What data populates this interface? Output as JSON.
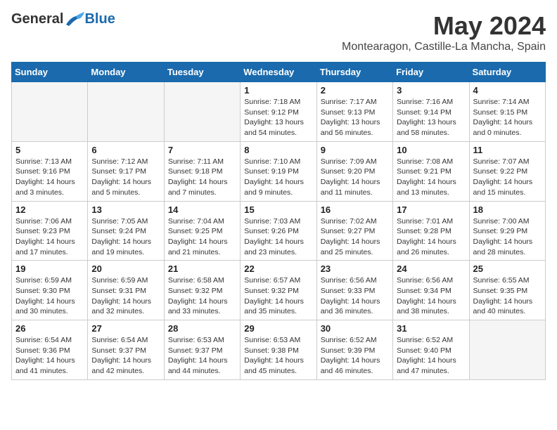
{
  "header": {
    "logo_general": "General",
    "logo_blue": "Blue",
    "title": "May 2024",
    "subtitle": "Montearagon, Castille-La Mancha, Spain"
  },
  "days_of_week": [
    "Sunday",
    "Monday",
    "Tuesday",
    "Wednesday",
    "Thursday",
    "Friday",
    "Saturday"
  ],
  "weeks": [
    [
      {
        "day": "",
        "info": ""
      },
      {
        "day": "",
        "info": ""
      },
      {
        "day": "",
        "info": ""
      },
      {
        "day": "1",
        "info": "Sunrise: 7:18 AM\nSunset: 9:12 PM\nDaylight: 13 hours\nand 54 minutes."
      },
      {
        "day": "2",
        "info": "Sunrise: 7:17 AM\nSunset: 9:13 PM\nDaylight: 13 hours\nand 56 minutes."
      },
      {
        "day": "3",
        "info": "Sunrise: 7:16 AM\nSunset: 9:14 PM\nDaylight: 13 hours\nand 58 minutes."
      },
      {
        "day": "4",
        "info": "Sunrise: 7:14 AM\nSunset: 9:15 PM\nDaylight: 14 hours\nand 0 minutes."
      }
    ],
    [
      {
        "day": "5",
        "info": "Sunrise: 7:13 AM\nSunset: 9:16 PM\nDaylight: 14 hours\nand 3 minutes."
      },
      {
        "day": "6",
        "info": "Sunrise: 7:12 AM\nSunset: 9:17 PM\nDaylight: 14 hours\nand 5 minutes."
      },
      {
        "day": "7",
        "info": "Sunrise: 7:11 AM\nSunset: 9:18 PM\nDaylight: 14 hours\nand 7 minutes."
      },
      {
        "day": "8",
        "info": "Sunrise: 7:10 AM\nSunset: 9:19 PM\nDaylight: 14 hours\nand 9 minutes."
      },
      {
        "day": "9",
        "info": "Sunrise: 7:09 AM\nSunset: 9:20 PM\nDaylight: 14 hours\nand 11 minutes."
      },
      {
        "day": "10",
        "info": "Sunrise: 7:08 AM\nSunset: 9:21 PM\nDaylight: 14 hours\nand 13 minutes."
      },
      {
        "day": "11",
        "info": "Sunrise: 7:07 AM\nSunset: 9:22 PM\nDaylight: 14 hours\nand 15 minutes."
      }
    ],
    [
      {
        "day": "12",
        "info": "Sunrise: 7:06 AM\nSunset: 9:23 PM\nDaylight: 14 hours\nand 17 minutes."
      },
      {
        "day": "13",
        "info": "Sunrise: 7:05 AM\nSunset: 9:24 PM\nDaylight: 14 hours\nand 19 minutes."
      },
      {
        "day": "14",
        "info": "Sunrise: 7:04 AM\nSunset: 9:25 PM\nDaylight: 14 hours\nand 21 minutes."
      },
      {
        "day": "15",
        "info": "Sunrise: 7:03 AM\nSunset: 9:26 PM\nDaylight: 14 hours\nand 23 minutes."
      },
      {
        "day": "16",
        "info": "Sunrise: 7:02 AM\nSunset: 9:27 PM\nDaylight: 14 hours\nand 25 minutes."
      },
      {
        "day": "17",
        "info": "Sunrise: 7:01 AM\nSunset: 9:28 PM\nDaylight: 14 hours\nand 26 minutes."
      },
      {
        "day": "18",
        "info": "Sunrise: 7:00 AM\nSunset: 9:29 PM\nDaylight: 14 hours\nand 28 minutes."
      }
    ],
    [
      {
        "day": "19",
        "info": "Sunrise: 6:59 AM\nSunset: 9:30 PM\nDaylight: 14 hours\nand 30 minutes."
      },
      {
        "day": "20",
        "info": "Sunrise: 6:59 AM\nSunset: 9:31 PM\nDaylight: 14 hours\nand 32 minutes."
      },
      {
        "day": "21",
        "info": "Sunrise: 6:58 AM\nSunset: 9:32 PM\nDaylight: 14 hours\nand 33 minutes."
      },
      {
        "day": "22",
        "info": "Sunrise: 6:57 AM\nSunset: 9:32 PM\nDaylight: 14 hours\nand 35 minutes."
      },
      {
        "day": "23",
        "info": "Sunrise: 6:56 AM\nSunset: 9:33 PM\nDaylight: 14 hours\nand 36 minutes."
      },
      {
        "day": "24",
        "info": "Sunrise: 6:56 AM\nSunset: 9:34 PM\nDaylight: 14 hours\nand 38 minutes."
      },
      {
        "day": "25",
        "info": "Sunrise: 6:55 AM\nSunset: 9:35 PM\nDaylight: 14 hours\nand 40 minutes."
      }
    ],
    [
      {
        "day": "26",
        "info": "Sunrise: 6:54 AM\nSunset: 9:36 PM\nDaylight: 14 hours\nand 41 minutes."
      },
      {
        "day": "27",
        "info": "Sunrise: 6:54 AM\nSunset: 9:37 PM\nDaylight: 14 hours\nand 42 minutes."
      },
      {
        "day": "28",
        "info": "Sunrise: 6:53 AM\nSunset: 9:37 PM\nDaylight: 14 hours\nand 44 minutes."
      },
      {
        "day": "29",
        "info": "Sunrise: 6:53 AM\nSunset: 9:38 PM\nDaylight: 14 hours\nand 45 minutes."
      },
      {
        "day": "30",
        "info": "Sunrise: 6:52 AM\nSunset: 9:39 PM\nDaylight: 14 hours\nand 46 minutes."
      },
      {
        "day": "31",
        "info": "Sunrise: 6:52 AM\nSunset: 9:40 PM\nDaylight: 14 hours\nand 47 minutes."
      },
      {
        "day": "",
        "info": ""
      }
    ]
  ]
}
